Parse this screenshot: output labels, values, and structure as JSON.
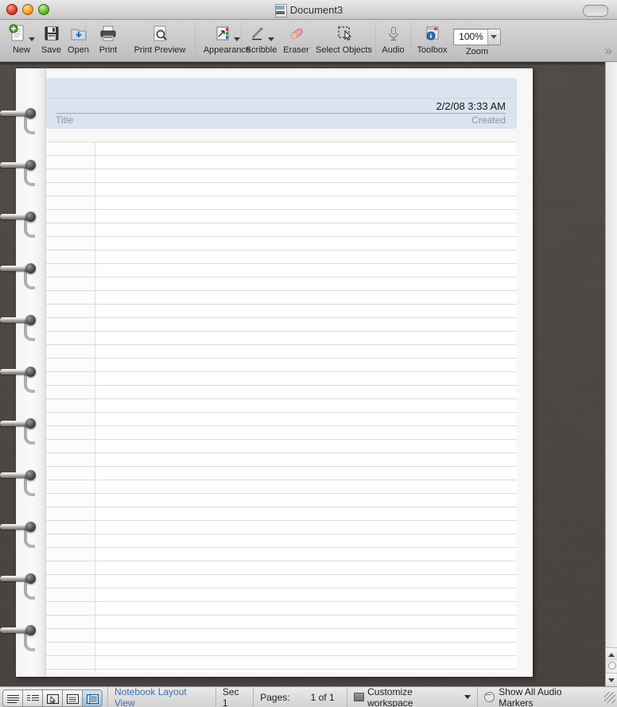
{
  "window": {
    "title": "Document3",
    "doc_icon": "document-icon",
    "controls": {
      "close": "close-button",
      "minimize": "minimize-button",
      "zoom": "zoom-button"
    },
    "toolbar_toggle": "toolbar-toggle-button"
  },
  "toolbar": {
    "items": [
      {
        "label": "New",
        "icon": "new-document-icon",
        "caret": true
      },
      {
        "label": "Save",
        "icon": "save-floppy-icon",
        "caret": false
      },
      {
        "label": "Open",
        "icon": "open-folder-icon",
        "caret": false
      },
      {
        "label": "Print",
        "icon": "printer-icon",
        "caret": false
      },
      {
        "label": "Print Preview",
        "icon": "print-preview-icon",
        "caret": false
      },
      {
        "label": "Appearance",
        "icon": "appearance-icon",
        "caret": true
      },
      {
        "label": "Scribble",
        "icon": "pencil-icon",
        "caret": true
      },
      {
        "label": "Eraser",
        "icon": "eraser-icon",
        "caret": false
      },
      {
        "label": "Select Objects",
        "icon": "marquee-select-icon",
        "caret": false
      },
      {
        "label": "Audio",
        "icon": "microphone-icon",
        "caret": false
      },
      {
        "label": "Toolbox",
        "icon": "toolbox-info-icon",
        "caret": false
      }
    ],
    "zoom": {
      "label": "Zoom",
      "value": "100%",
      "caret_icon": "chevron-down-icon"
    },
    "overflow": "»"
  },
  "document": {
    "header": {
      "created_value": "2/2/08 3:33 AM",
      "title_label": "Title",
      "created_label": "Created",
      "band_color": "#d9e4ef"
    },
    "page": {
      "line_count": 39,
      "paper_color": "#ffffff",
      "rule_color": "#dcdcdc"
    },
    "rings": 11
  },
  "scrollbar": {
    "up_arrow": "scroll-up-arrow",
    "down_arrow": "scroll-down-arrow",
    "split_control": "scroll-split-control"
  },
  "statusbar": {
    "view_buttons": [
      {
        "name": "draft-view",
        "active": false
      },
      {
        "name": "outline-view",
        "active": false
      },
      {
        "name": "publishing-layout-view",
        "active": false
      },
      {
        "name": "print-layout-view",
        "active": false
      },
      {
        "name": "notebook-layout-view",
        "active": true
      }
    ],
    "view_name": "Notebook Layout View",
    "section": "Sec 1",
    "pages_label": "Pages:",
    "pages_value": "1 of 1",
    "customize_workspace": "Customize workspace",
    "show_audio_markers": "Show All Audio Markers",
    "resize_grip": "resize-grip"
  }
}
